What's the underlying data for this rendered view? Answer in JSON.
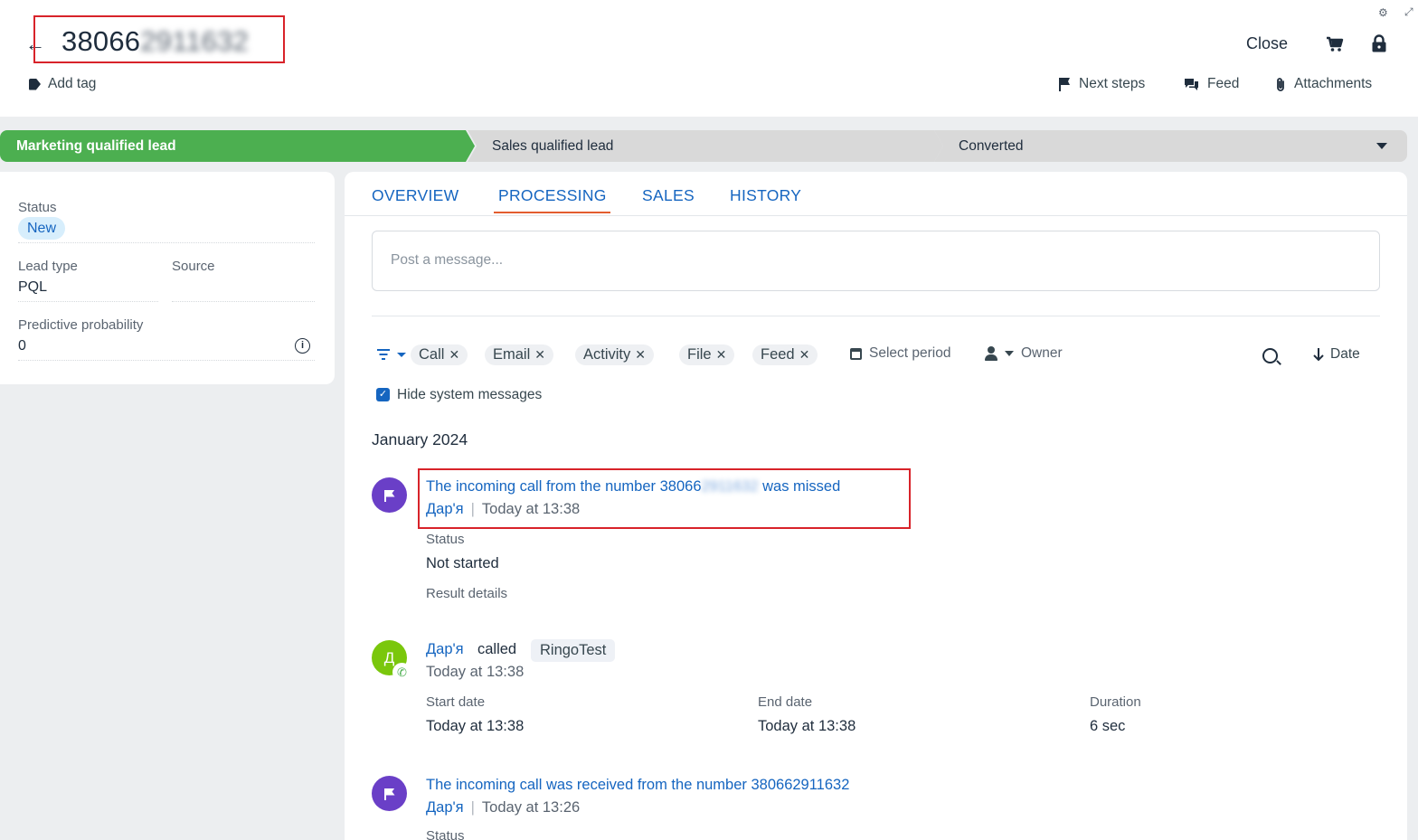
{
  "header": {
    "title_visible": "38066",
    "title_blurred": "2911632",
    "add_tag": "Add tag",
    "close": "Close",
    "next_steps": "Next steps",
    "feed": "Feed",
    "attachments": "Attachments"
  },
  "stages": [
    "Marketing qualified lead",
    "Sales qualified lead",
    "Converted"
  ],
  "left_card": {
    "status_label": "Status",
    "status_value": "New",
    "lead_type_label": "Lead type",
    "lead_type_value": "PQL",
    "source_label": "Source",
    "source_value": "",
    "predictive_label": "Predictive probability",
    "predictive_value": "0"
  },
  "tabs": [
    {
      "label": "OVERVIEW",
      "active": false
    },
    {
      "label": "PROCESSING",
      "active": true
    },
    {
      "label": "SALES",
      "active": false
    },
    {
      "label": "HISTORY",
      "active": false
    }
  ],
  "composer": {
    "placeholder": "Post a message..."
  },
  "filters": {
    "chips": [
      "Call",
      "Email",
      "Activity",
      "File",
      "Feed"
    ],
    "select_period": "Select period",
    "owner": "Owner",
    "sort": "Date",
    "hide_system": "Hide system messages",
    "hide_system_checked": true
  },
  "timeline": {
    "month": "January 2024",
    "entry1": {
      "title_prefix": "The incoming call from the number 38066",
      "title_blurred": "2911632",
      "title_suffix": " was missed",
      "author": "Дар'я",
      "time": "Today at 13:38",
      "status_label": "Status",
      "status_value": "Not started",
      "result_label": "Result details"
    },
    "entry2": {
      "avatar_letter": "Д",
      "author": "Дар'я",
      "action": "called",
      "target": "RingoTest",
      "time": "Today at 13:38",
      "start_label": "Start date",
      "start_value": "Today at 13:38",
      "end_label": "End date",
      "end_value": "Today at 13:38",
      "duration_label": "Duration",
      "duration_value": "6 sec"
    },
    "entry3": {
      "title": "The incoming call was received from the number 380662911632",
      "author": "Дар'я",
      "time": "Today at 13:26",
      "status_label": "Status"
    }
  },
  "colors": {
    "accent_blue": "#1565c0",
    "stage_active": "#4caf50",
    "tab_underline": "#e35d2f",
    "highlight_red": "#d8232a"
  }
}
